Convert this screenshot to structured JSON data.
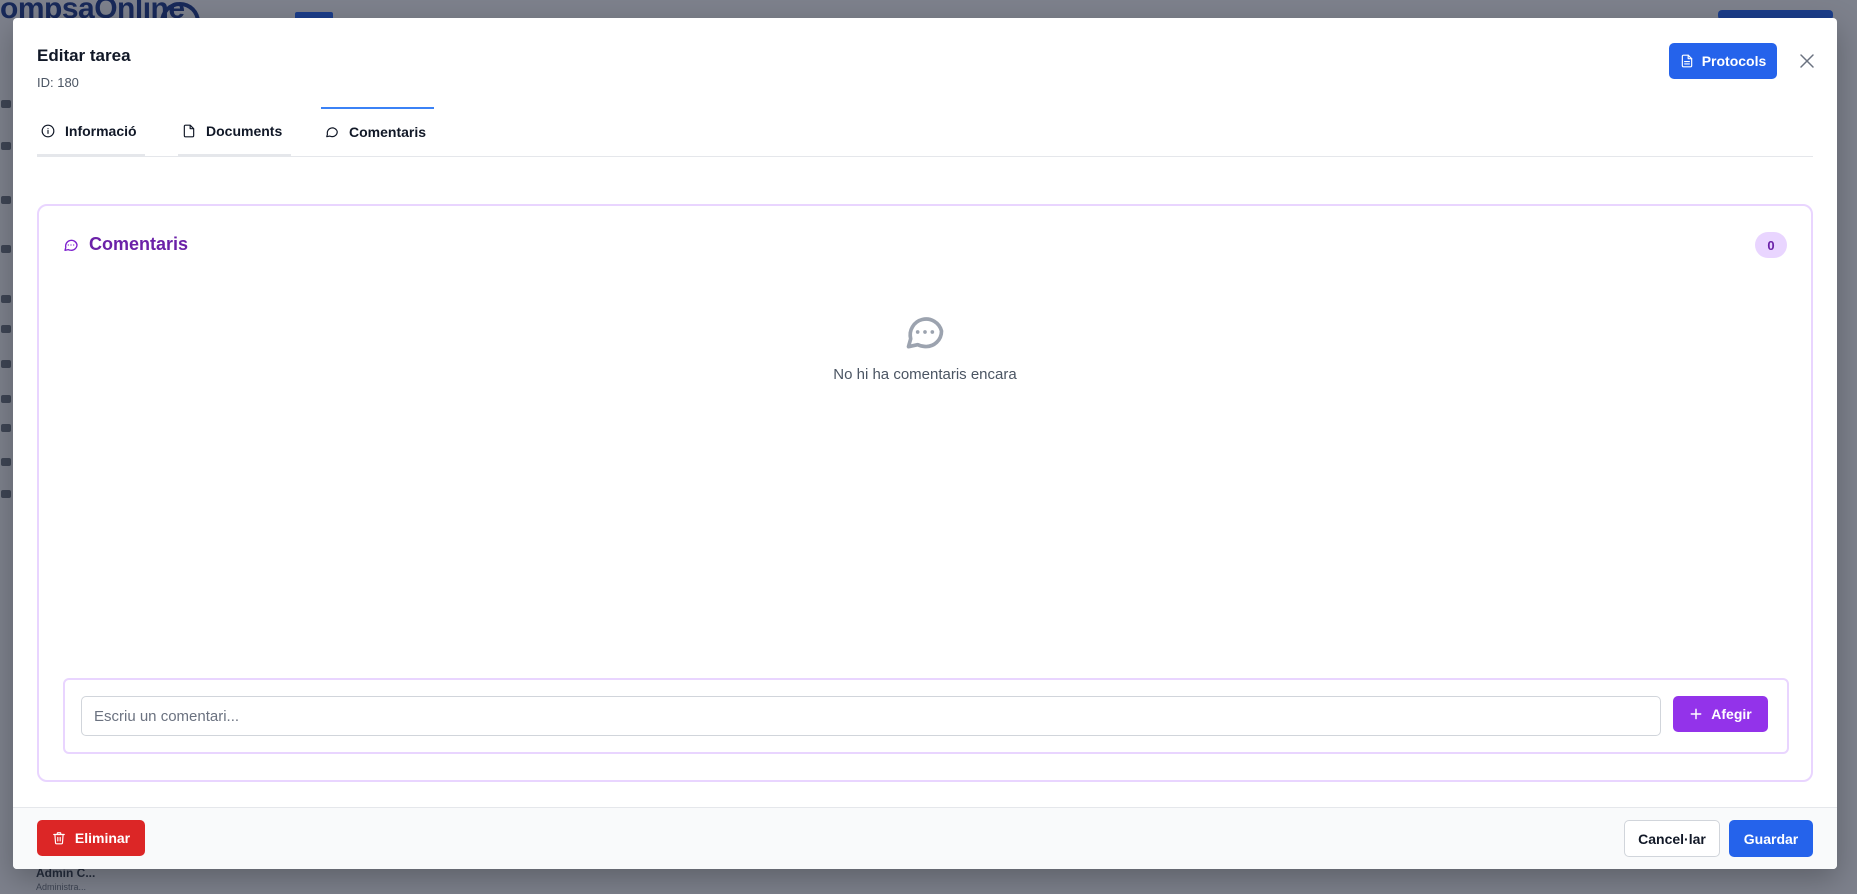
{
  "background": {
    "logo_text": "ompsaOnline",
    "admin_name": "Admin C...",
    "admin_sub": "Administra..."
  },
  "modal": {
    "title": "Editar tarea",
    "subtitle": "ID: 180",
    "protocols_label": "Protocols"
  },
  "tabs": [
    {
      "label": "Informació",
      "icon": "info-icon",
      "active": false
    },
    {
      "label": "Documents",
      "icon": "file-icon",
      "active": false
    },
    {
      "label": "Comentaris",
      "icon": "message-icon",
      "active": true
    }
  ],
  "comments": {
    "title": "Comentaris",
    "count": "0",
    "empty_text": "No hi ha comentaris encara",
    "input_value": "",
    "input_placeholder": "Escriu un comentari...",
    "add_label": "Afegir"
  },
  "footer": {
    "delete_label": "Eliminar",
    "cancel_label": "Cancel·lar",
    "save_label": "Guardar"
  },
  "colors": {
    "primary": "#2563eb",
    "accent_purple": "#9333ea",
    "danger": "#dc2626",
    "purple_border": "#e9d5ff"
  }
}
